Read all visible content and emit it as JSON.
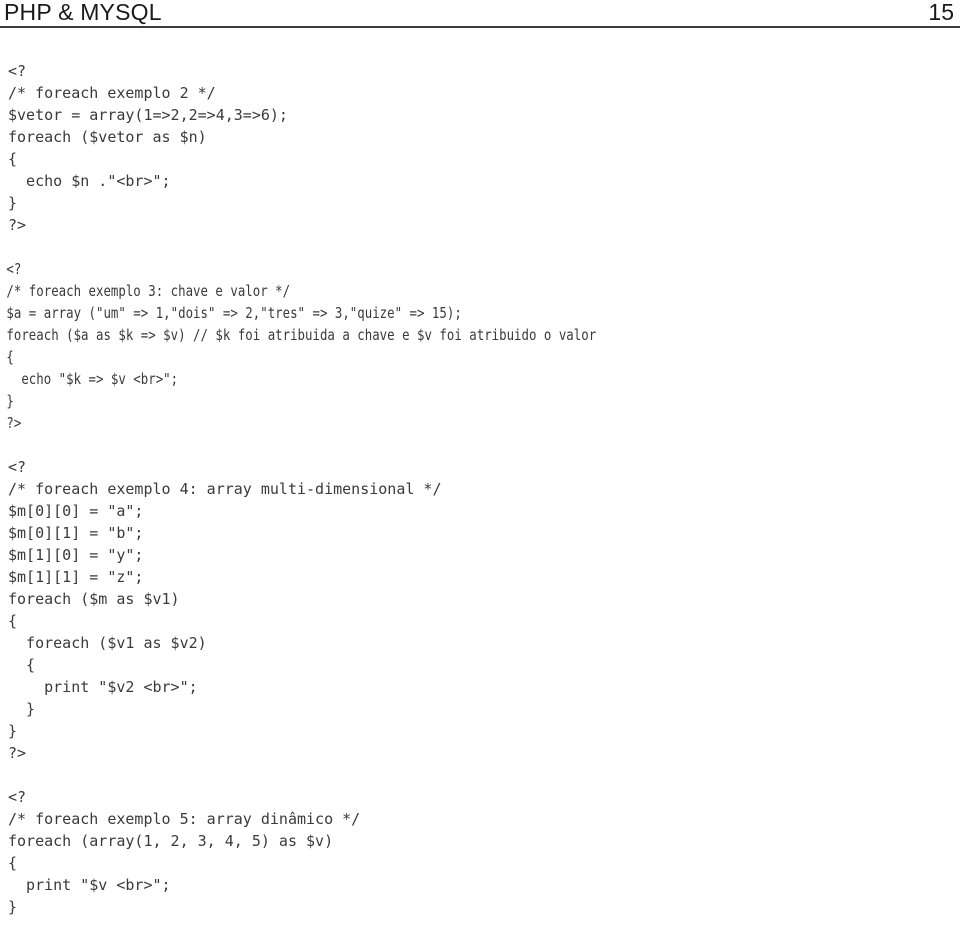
{
  "header": {
    "title": "PHP & MYSQL",
    "page_number": "15",
    "rule_color": "#3c3c3c"
  },
  "document": {
    "text_color": "#3a3a3a",
    "background_color": "#ffffff",
    "blocks": [
      {
        "id": "foreach-exemplo-2",
        "condensed": false,
        "lines": [
          "<?",
          "/* foreach exemplo 2 */",
          "$vetor = array(1=>2,2=>4,3=>6);",
          "foreach ($vetor as $n)",
          "{",
          "  echo $n .\"<br>\";",
          "}",
          "?>"
        ]
      },
      {
        "id": "foreach-exemplo-3",
        "condensed": true,
        "lines": [
          "<?",
          "/* foreach exemplo 3: chave e valor */",
          "$a = array (\"um\" => 1,\"dois\" => 2,\"tres\" => 3,\"quize\" => 15);",
          "foreach ($a as $k => $v) // $k foi atribuida a chave e $v foi atribuido o valor",
          "{",
          "  echo \"$k => $v <br>\";",
          "}",
          "?>"
        ]
      },
      {
        "id": "foreach-exemplo-4",
        "condensed": false,
        "lines": [
          "<?",
          "/* foreach exemplo 4: array multi-dimensional */",
          "$m[0][0] = \"a\";",
          "$m[0][1] = \"b\";",
          "$m[1][0] = \"y\";",
          "$m[1][1] = \"z\";",
          "foreach ($m as $v1)",
          "{",
          "  foreach ($v1 as $v2)",
          "  {",
          "    print \"$v2 <br>\";",
          "  }",
          "}",
          "?>"
        ]
      },
      {
        "id": "foreach-exemplo-5",
        "condensed": false,
        "lines": [
          "<?",
          "/* foreach exemplo 5: array dinâmico */",
          "foreach (array(1, 2, 3, 4, 5) as $v)",
          "{",
          "  print \"$v <br>\";",
          "}"
        ]
      }
    ]
  }
}
